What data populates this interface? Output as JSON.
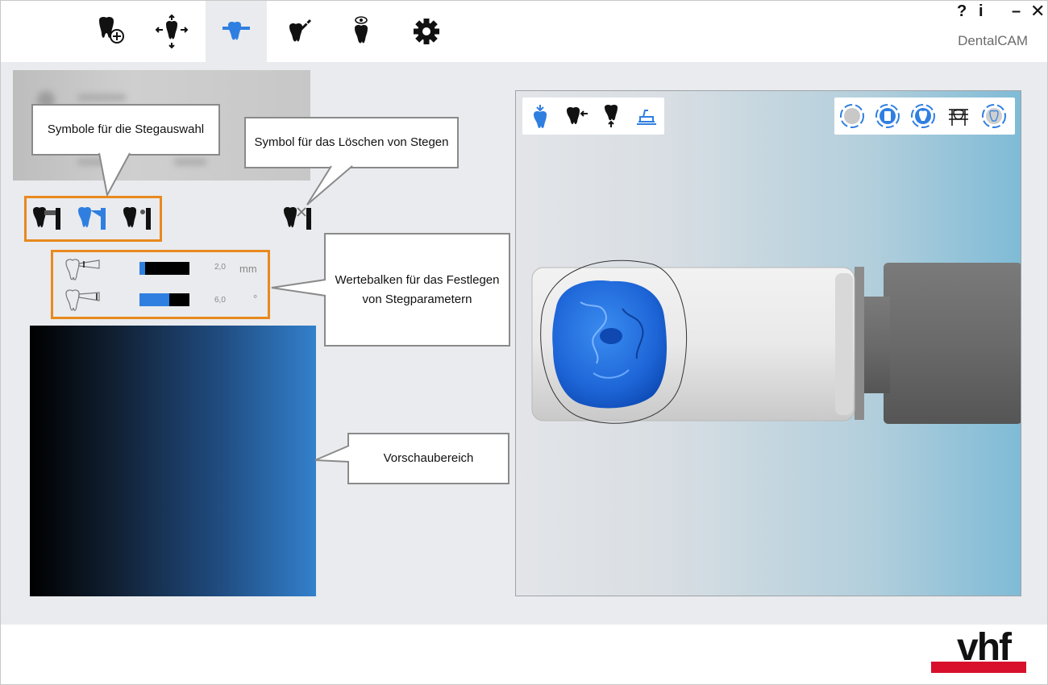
{
  "app": {
    "title": "DentalCAM",
    "window_controls": {
      "help": "?",
      "info": "i",
      "minimize": "–",
      "close": "✕"
    }
  },
  "toolbar_tabs": [
    {
      "id": "tooth-job",
      "icon": "tooth-plus-icon",
      "active": false
    },
    {
      "id": "position",
      "icon": "tooth-move-icon",
      "active": false
    },
    {
      "id": "bridges",
      "icon": "tooth-bridge-icon",
      "active": true
    },
    {
      "id": "tooth-tools",
      "icon": "tooth-tool-icon",
      "active": false
    },
    {
      "id": "tooth-view",
      "icon": "tooth-eye-icon",
      "active": false
    },
    {
      "id": "settings",
      "icon": "gear-icon",
      "active": false
    }
  ],
  "callouts": {
    "bridge_select": "Symbole für die Stegauswahl",
    "bridge_delete": "Symbol für das Löschen von Stegen",
    "value_bars": "Wertebalken für das Festlegen von Stegparametern",
    "preview": "Vorschaubereich"
  },
  "params": [
    {
      "label": "diameter",
      "value": "2,0",
      "unit": "mm",
      "fill_percent": 12
    },
    {
      "label": "angle",
      "value": "6,0",
      "unit": "°",
      "fill_percent": 60
    }
  ],
  "colors": {
    "accent": "#2f7fe0",
    "highlight_border": "#e8891e",
    "logo_red": "#d8102c"
  },
  "logo": {
    "text": "vhf"
  }
}
